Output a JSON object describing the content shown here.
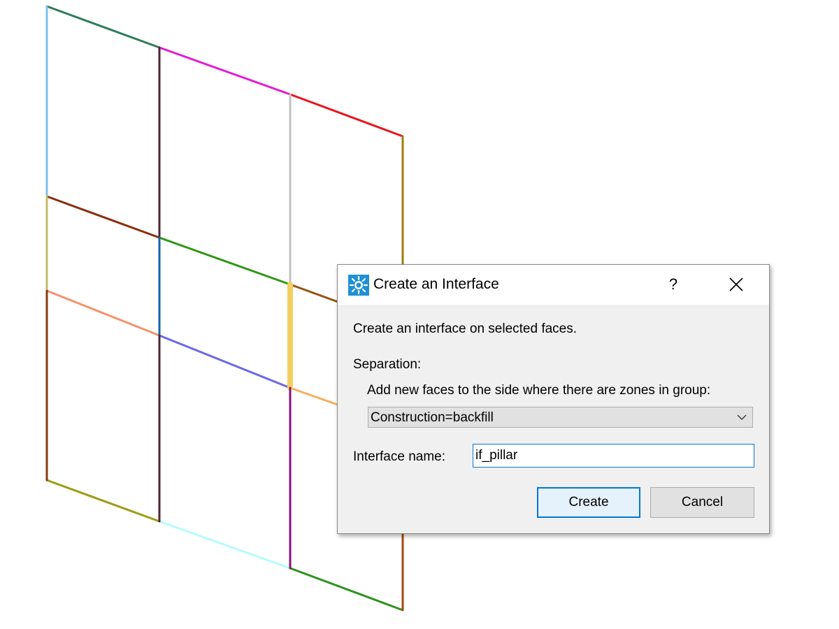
{
  "dialog": {
    "title": "Create an Interface",
    "help_label": "?",
    "description": "Create an interface on selected faces.",
    "separation_label": "Separation:",
    "separation_instruction": "Add new faces to the side where there are zones in group:",
    "group_select": {
      "selected": "Construction=backfill"
    },
    "interface_name_label": "Interface name:",
    "interface_name_value": "if_pillar",
    "create_label": "Create",
    "cancel_label": "Cancel"
  },
  "colors": {
    "accent": "#0078d7",
    "dialog_background": "#f0f0f0",
    "titlebar_background": "#ffffff",
    "app_icon": "#1e90d6"
  },
  "icons": {
    "app": "itasca-app-icon",
    "close": "close-icon",
    "dropdown": "chevron-down-icon"
  }
}
